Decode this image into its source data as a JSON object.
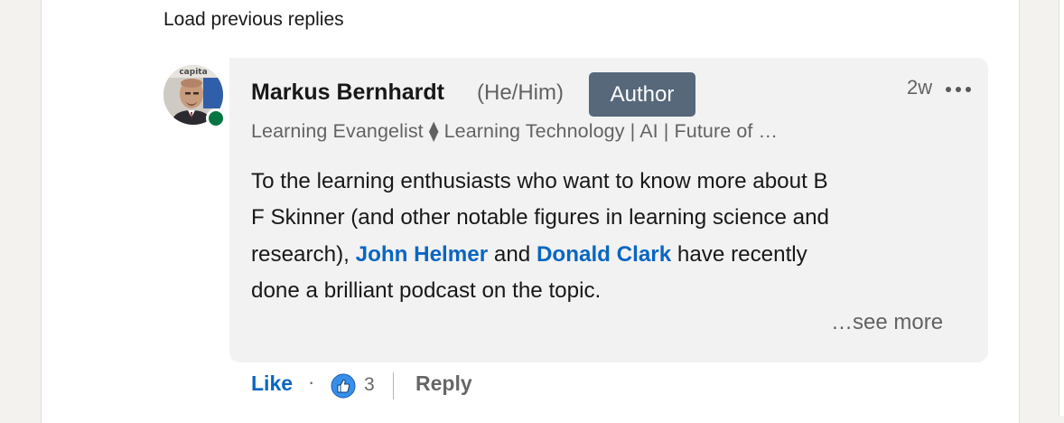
{
  "load_previous": "Load previous replies",
  "comment": {
    "author": {
      "name": "Markus Bernhardt",
      "pronouns": "(He/Him)",
      "badge": "Author",
      "headline": "Learning Evangelist ⧫ Learning Technology | AI | Future of …",
      "avatar_text": "capita",
      "presence": "online"
    },
    "time": "2w",
    "body": {
      "line1": "To the learning enthusiasts who want to know more about B",
      "line2": "F Skinner (and other notable figures in learning science and",
      "line3_pre": "research),",
      "mention1": "John Helmer",
      "line3_mid": "and",
      "mention2": "Donald Clark",
      "line3_post": "have recently",
      "line4": "done a brilliant podcast on the topic."
    },
    "see_more": "…see more",
    "actions": {
      "like": "Like",
      "separator": "·",
      "reaction_count": "3",
      "reply": "Reply"
    }
  },
  "colors": {
    "accent": "#0a66c2",
    "badge_bg": "#56687a",
    "bubble_bg": "#f2f2f2",
    "presence": "#057642"
  },
  "icons": {
    "more": "three-dots-icon",
    "reaction": "thumbs-up-like-icon",
    "presence": "online-status-icon"
  }
}
